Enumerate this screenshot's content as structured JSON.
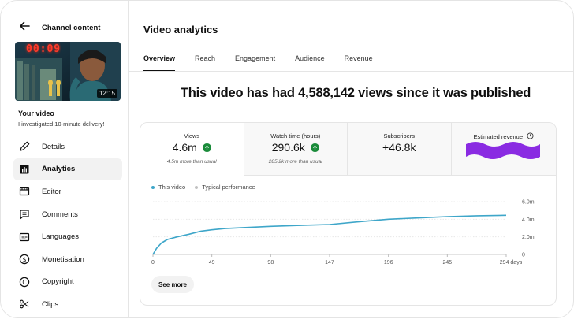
{
  "sidebar": {
    "back_title": "Channel content",
    "thumbnail": {
      "clock": "00:09",
      "duration": "12:15"
    },
    "your_video_label": "Your video",
    "video_title": "I investigated 10-minute delivery!",
    "items": [
      {
        "label": "Details",
        "icon": "pencil-icon"
      },
      {
        "label": "Analytics",
        "icon": "analytics-icon",
        "active": true
      },
      {
        "label": "Editor",
        "icon": "editor-icon"
      },
      {
        "label": "Comments",
        "icon": "comments-icon"
      },
      {
        "label": "Languages",
        "icon": "subtitles-icon"
      },
      {
        "label": "Monetisation",
        "icon": "dollar-icon"
      },
      {
        "label": "Copyright",
        "icon": "copyright-icon"
      },
      {
        "label": "Clips",
        "icon": "scissors-icon"
      }
    ]
  },
  "main": {
    "title": "Video analytics",
    "tabs": [
      "Overview",
      "Reach",
      "Engagement",
      "Audience",
      "Revenue"
    ],
    "active_tab": "Overview",
    "headline": "This video has had 4,588,142 views since it was published",
    "stats": [
      {
        "label": "Views",
        "value": "4.6m",
        "trend": "up",
        "note": "4.5m more than usual"
      },
      {
        "label": "Watch time (hours)",
        "value": "290.6k",
        "trend": "up",
        "note": "285.2k more than usual"
      },
      {
        "label": "Subscribers",
        "value": "+46.8k"
      },
      {
        "label": "Estimated revenue",
        "redacted": true
      }
    ],
    "legend": {
      "this_video": "This video",
      "typical": "Typical performance"
    },
    "see_more": "See more"
  },
  "colors": {
    "accent": "#3ea6c9",
    "up_green": "#1a8b3a",
    "redaction": "#8a2be2",
    "typical_grey": "#c0c0c0"
  },
  "chart_data": {
    "type": "line",
    "x": [
      0,
      3,
      7,
      12,
      20,
      30,
      40,
      49,
      60,
      75,
      98,
      120,
      147,
      170,
      196,
      220,
      245,
      270,
      294
    ],
    "series": [
      {
        "name": "This video",
        "values": [
          0,
          0.7,
          1.3,
          1.7,
          2.0,
          2.3,
          2.65,
          2.8,
          2.95,
          3.05,
          3.2,
          3.3,
          3.4,
          3.7,
          4.0,
          4.15,
          4.3,
          4.4,
          4.45
        ]
      }
    ],
    "x_ticks": [
      "0",
      "49",
      "98",
      "147",
      "196",
      "245",
      "294 days"
    ],
    "x_tick_values": [
      0,
      49,
      98,
      147,
      196,
      245,
      294
    ],
    "y_ticks": [
      "0",
      "2.0m",
      "4.0m",
      "6.0m"
    ],
    "y_tick_values": [
      0,
      2,
      4,
      6
    ],
    "xlim": [
      0,
      294
    ],
    "ylim": [
      0,
      6
    ],
    "grid": true,
    "legend": "top-left"
  }
}
